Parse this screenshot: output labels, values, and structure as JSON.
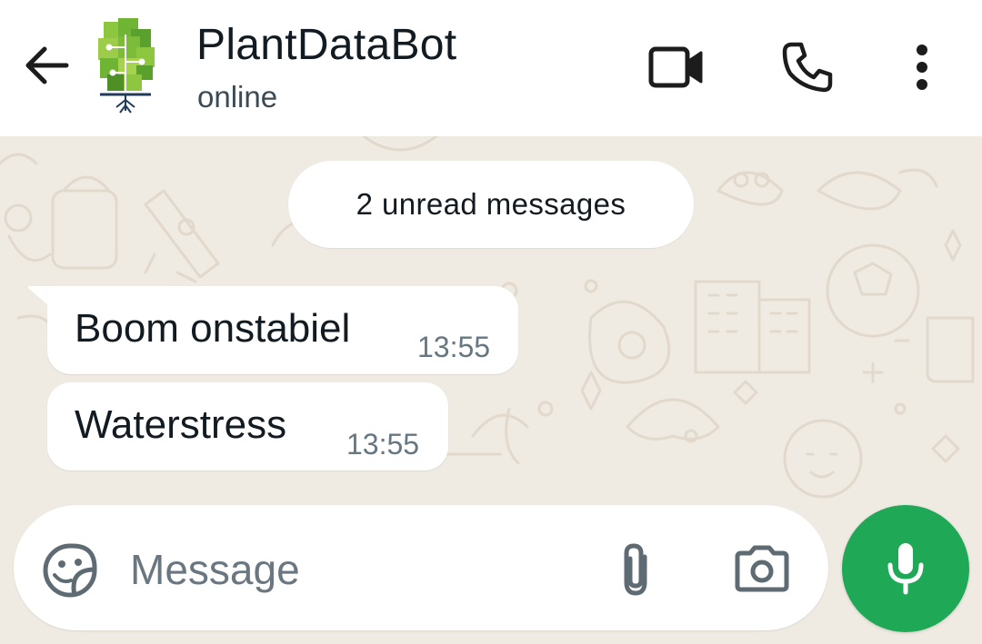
{
  "header": {
    "contact_name": "PlantDataBot",
    "status": "online",
    "icons": {
      "back": "arrow-left-icon",
      "video": "video-camera-icon",
      "call": "phone-icon",
      "menu": "more-vertical-icon"
    }
  },
  "chat": {
    "unread_banner": "2 unread messages",
    "messages": [
      {
        "text": "Boom onstabiel",
        "time": "13:55"
      },
      {
        "text": "Waterstress",
        "time": "13:55"
      }
    ]
  },
  "composer": {
    "placeholder": "Message",
    "icons": {
      "sticker": "sticker-icon",
      "attach": "paperclip-icon",
      "camera": "camera-icon",
      "mic": "microphone-icon"
    }
  },
  "colors": {
    "accent": "#1fa855",
    "wallpaper": "#efeae2",
    "bubble": "#ffffff",
    "primary_text": "#111b21",
    "secondary_text": "#667781"
  }
}
